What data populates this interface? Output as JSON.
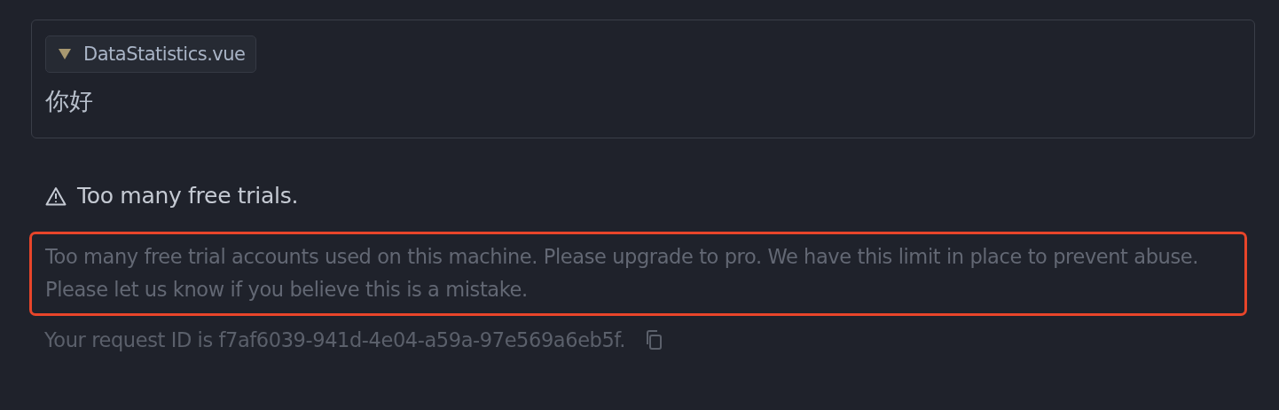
{
  "context": {
    "file_chip": "DataStatistics.vue",
    "message": "你好"
  },
  "error": {
    "title": "Too many free trials.",
    "message": "Too many free trial accounts used on this machine. Please upgrade to pro. We have this limit in place to prevent abuse. Please let us know if you believe this is a mistake.",
    "request_id": "Your request ID is f7af6039-941d-4e04-a59a-97e569a6eb5f."
  }
}
